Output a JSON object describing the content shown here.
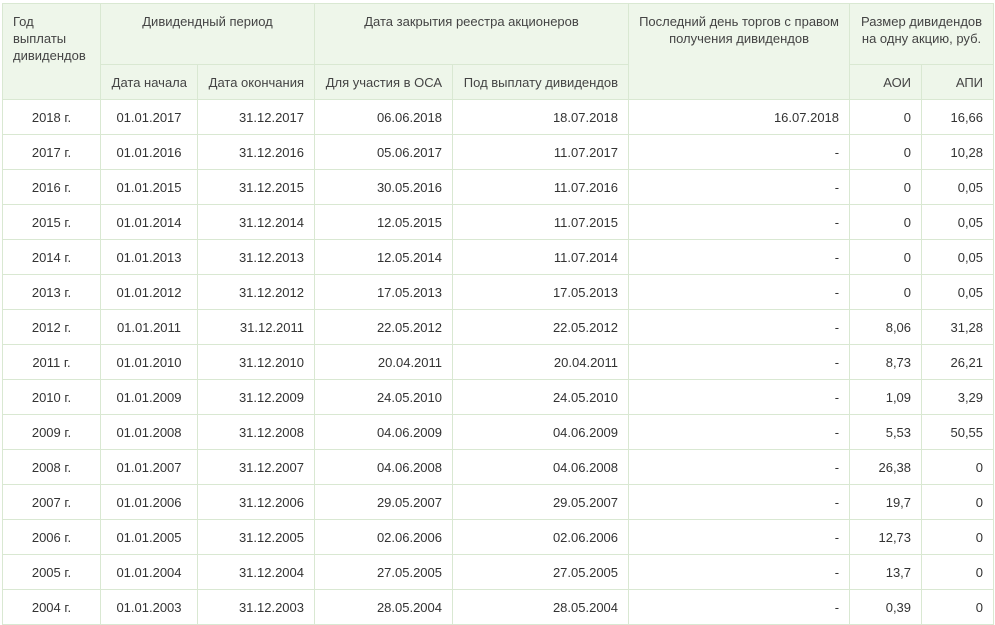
{
  "header": {
    "year": "Год выплаты дивидендов",
    "period": "Дивидендный период",
    "registry": "Дата закрытия реестра акционеров",
    "last_day": "Последний день торгов с правом получения дивидендов",
    "size": "Размер дивидендов на одну акцию, руб.",
    "start": "Дата начала",
    "end": "Дата окончания",
    "osa": "Для участия в ОСА",
    "payout": "Под выплату дивидендов",
    "aoi": "АОИ",
    "api": "АПИ"
  },
  "rows": [
    {
      "year": "2018 г.",
      "start": "01.01.2017",
      "end": "31.12.2017",
      "osa": "06.06.2018",
      "payout": "18.07.2018",
      "last": "16.07.2018",
      "aoi": "0",
      "api": "16,66"
    },
    {
      "year": "2017 г.",
      "start": "01.01.2016",
      "end": "31.12.2016",
      "osa": "05.06.2017",
      "payout": "11.07.2017",
      "last": "-",
      "aoi": "0",
      "api": "10,28"
    },
    {
      "year": "2016 г.",
      "start": "01.01.2015",
      "end": "31.12.2015",
      "osa": "30.05.2016",
      "payout": "11.07.2016",
      "last": "-",
      "aoi": "0",
      "api": "0,05"
    },
    {
      "year": "2015 г.",
      "start": "01.01.2014",
      "end": "31.12.2014",
      "osa": "12.05.2015",
      "payout": "11.07.2015",
      "last": "-",
      "aoi": "0",
      "api": "0,05"
    },
    {
      "year": "2014 г.",
      "start": "01.01.2013",
      "end": "31.12.2013",
      "osa": "12.05.2014",
      "payout": "11.07.2014",
      "last": "-",
      "aoi": "0",
      "api": "0,05"
    },
    {
      "year": "2013 г.",
      "start": "01.01.2012",
      "end": "31.12.2012",
      "osa": "17.05.2013",
      "payout": "17.05.2013",
      "last": "-",
      "aoi": "0",
      "api": "0,05"
    },
    {
      "year": "2012 г.",
      "start": "01.01.2011",
      "end": "31.12.2011",
      "osa": "22.05.2012",
      "payout": "22.05.2012",
      "last": "-",
      "aoi": "8,06",
      "api": "31,28"
    },
    {
      "year": "2011 г.",
      "start": "01.01.2010",
      "end": "31.12.2010",
      "osa": "20.04.2011",
      "payout": "20.04.2011",
      "last": "-",
      "aoi": "8,73",
      "api": "26,21"
    },
    {
      "year": "2010 г.",
      "start": "01.01.2009",
      "end": "31.12.2009",
      "osa": "24.05.2010",
      "payout": "24.05.2010",
      "last": "-",
      "aoi": "1,09",
      "api": "3,29"
    },
    {
      "year": "2009 г.",
      "start": "01.01.2008",
      "end": "31.12.2008",
      "osa": "04.06.2009",
      "payout": "04.06.2009",
      "last": "-",
      "aoi": "5,53",
      "api": "50,55"
    },
    {
      "year": "2008 г.",
      "start": "01.01.2007",
      "end": "31.12.2007",
      "osa": "04.06.2008",
      "payout": "04.06.2008",
      "last": "-",
      "aoi": "26,38",
      "api": "0"
    },
    {
      "year": "2007 г.",
      "start": "01.01.2006",
      "end": "31.12.2006",
      "osa": "29.05.2007",
      "payout": "29.05.2007",
      "last": "-",
      "aoi": "19,7",
      "api": "0"
    },
    {
      "year": "2006 г.",
      "start": "01.01.2005",
      "end": "31.12.2005",
      "osa": "02.06.2006",
      "payout": "02.06.2006",
      "last": "-",
      "aoi": "12,73",
      "api": "0"
    },
    {
      "year": "2005 г.",
      "start": "01.01.2004",
      "end": "31.12.2004",
      "osa": "27.05.2005",
      "payout": "27.05.2005",
      "last": "-",
      "aoi": "13,7",
      "api": "0"
    },
    {
      "year": "2004 г.",
      "start": "01.01.2003",
      "end": "31.12.2003",
      "osa": "28.05.2004",
      "payout": "28.05.2004",
      "last": "-",
      "aoi": "0,39",
      "api": "0"
    }
  ]
}
